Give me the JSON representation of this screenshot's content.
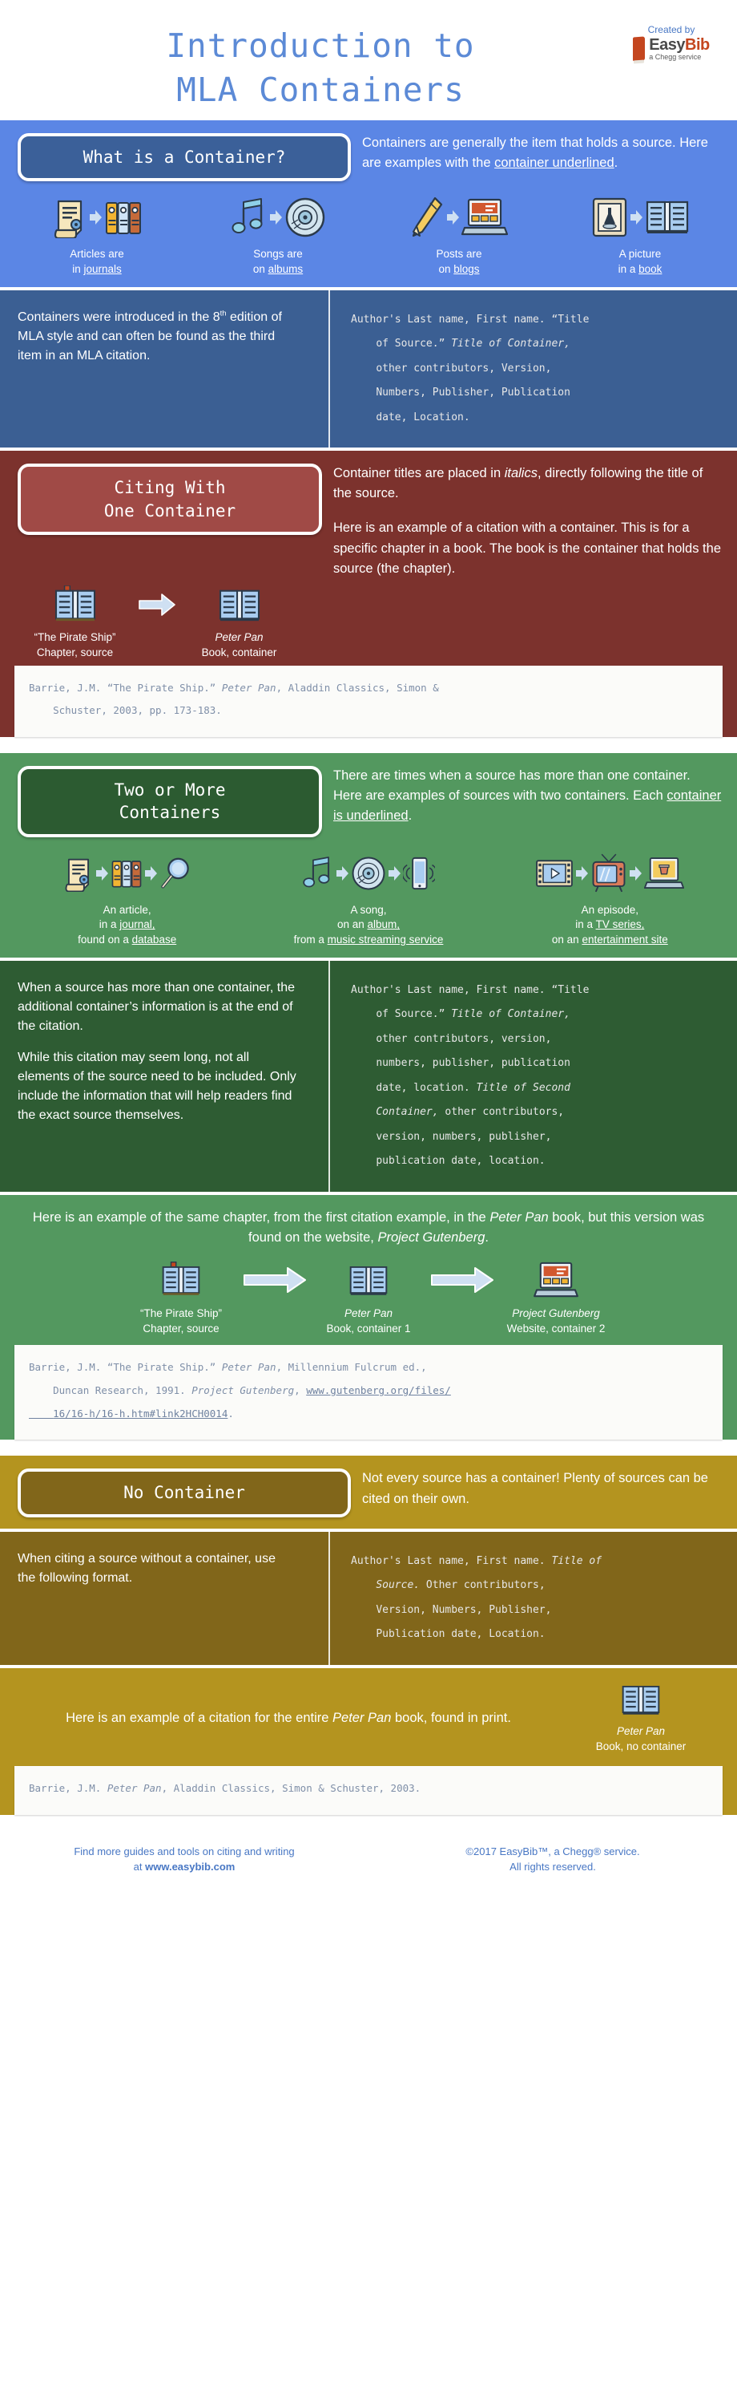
{
  "header": {
    "title_line1": "Introduction to",
    "title_line2": "MLA Containers",
    "created_by": "Created by",
    "logo_easy": "Easy",
    "logo_bib": "Bib",
    "logo_sub": "a Chegg service"
  },
  "section_what": {
    "badge": "What is a Container?",
    "intro_a": "Containers are generally the item that holds a source. Here are examples with the ",
    "intro_underline": "container underlined",
    "intro_b": ".",
    "examples": [
      {
        "icon_source": "article-scroll-icon",
        "icon_arrow": "arrow-right-icon",
        "icon_container": "books-row-icon",
        "line1": "Articles are",
        "line2_pre": "in ",
        "line2_underline": "journals",
        "line2_post": ""
      },
      {
        "icon_source": "music-notes-icon",
        "icon_arrow": "arrow-right-icon",
        "icon_container": "vinyl-disc-icon",
        "line1": "Songs are",
        "line2_pre": "on ",
        "line2_underline": "albums",
        "line2_post": ""
      },
      {
        "icon_source": "pencil-icon",
        "icon_arrow": "arrow-right-icon",
        "icon_container": "laptop-icon",
        "line1": "Posts are",
        "line2_pre": "on ",
        "line2_underline": "blogs",
        "line2_post": ""
      },
      {
        "icon_source": "framed-picture-icon",
        "icon_arrow": "arrow-right-icon",
        "icon_container": "open-book-icon",
        "line1": "A picture",
        "line2_pre": "in a ",
        "line2_underline": "book",
        "line2_post": ""
      }
    ],
    "body_pre": "Containers were introduced in the 8",
    "body_sup": "th",
    "body_post": " edition of MLA style and can often be found as the third item in an MLA citation.",
    "format": "Author's Last name, First name. “Title\n    of Source.” @@Title of Container,@@\n    other contributors, Version,\n    Numbers, Publisher, Publication\n    date, Location."
  },
  "section_one": {
    "badge_line1": "Citing With",
    "badge_line2": "One Container",
    "text_p1_a": "Container titles are placed in ",
    "text_p1_i": "italics",
    "text_p1_b": ", directly following the title of the source.",
    "text_p2": "Here is an example of a citation with a container. This is for a specific chapter in a book. The book is the container that holds the source (the chapter).",
    "flow": [
      {
        "icon": "open-book-bookmark-icon",
        "cap1": "“The Pirate Ship”",
        "cap2": "Chapter, source",
        "italic1": false
      },
      {
        "icon": "open-book-icon",
        "cap1": "Peter Pan",
        "cap2": "Book, container",
        "italic1": true
      }
    ],
    "arrow_icon": "arrow-right-large-icon",
    "citation": "Barrie, J.M. “The Pirate Ship.” @@Peter Pan@@, Aladdin Classics, Simon &\n    Schuster, 2003, pp. 173-183."
  },
  "section_two": {
    "badge_line1": "Two or More",
    "badge_line2": "Containers",
    "intro_a": "There are times when a source has more than one container. Here are examples of sources with two containers. Each ",
    "intro_underline": "container is underlined",
    "intro_b": ".",
    "examples": [
      {
        "icons": [
          "article-scroll-icon",
          "arrow-right-icon",
          "books-row-icon",
          "arrow-right-icon",
          "magnifier-icon"
        ],
        "lines": [
          {
            "pre": "An article,",
            "u": "",
            "post": ""
          },
          {
            "pre": "in a ",
            "u": "journal,",
            "post": ""
          },
          {
            "pre": "found on a ",
            "u": "database",
            "post": ""
          }
        ]
      },
      {
        "icons": [
          "music-notes-icon",
          "arrow-right-icon",
          "vinyl-disc-icon",
          "arrow-right-icon",
          "smartphone-icon"
        ],
        "lines": [
          {
            "pre": "A song,",
            "u": "",
            "post": ""
          },
          {
            "pre": "on an ",
            "u": "album,",
            "post": ""
          },
          {
            "pre": "from a ",
            "u": "music streaming service",
            "post": ""
          }
        ]
      },
      {
        "icons": [
          "film-strip-icon",
          "arrow-right-icon",
          "television-icon",
          "arrow-right-icon",
          "laptop-video-icon"
        ],
        "lines": [
          {
            "pre": "An episode,",
            "u": "",
            "post": ""
          },
          {
            "pre": "in a ",
            "u": "TV series,",
            "post": ""
          },
          {
            "pre": "on an ",
            "u": "entertainment site",
            "post": ""
          }
        ]
      }
    ],
    "body_p1": "When a source has more than one container, the additional container’s information is at the end of the citation.",
    "body_p2": "While this citation may seem long, not all elements of the source need to be included. Only include the information that will help readers find the exact source themselves.",
    "format": "Author's Last name, First name. “Title\n    of Source.” @@Title of Container,@@\n    other contributors, version,\n    numbers, publisher, publication\n    date, location. @@Title of Second\n    Container,@@ other contributors,\n    version, numbers, publisher,\n    publication date, location."
  },
  "section_gutenberg": {
    "head_a": "Here is an example of the same chapter, from the first citation example, in the ",
    "head_i": "Peter Pan",
    "head_b": " book, but this version was found on the website, ",
    "head_i2": "Project Gutenberg",
    "head_c": ".",
    "flow": [
      {
        "icon": "open-book-bookmark-icon",
        "cap1": "“The Pirate Ship”",
        "cap2": "Chapter, source",
        "italic1": false
      },
      {
        "icon": "open-book-icon",
        "cap1": "Peter Pan",
        "cap2": "Book, container 1",
        "italic1": true
      },
      {
        "icon": "laptop-icon",
        "cap1": "Project Gutenberg",
        "cap2": "Website, container 2",
        "italic1": true
      }
    ],
    "arrow_icon": "arrow-right-large-icon",
    "citation_pre": "Barrie, J.M. “The Pirate Ship.” ",
    "citation_i1": "Peter Pan",
    "citation_mid": ", Millennium Fulcrum ed.,\n    Duncan Research, 1991. ",
    "citation_i2": "Project Gutenberg",
    "citation_post": ", ",
    "citation_url": "www.gutenberg.org/files/\n    16/16-h/16-h.htm#link2HCH0014",
    "citation_end": "."
  },
  "section_none": {
    "badge": "No Container",
    "intro": "Not every source has a container! Plenty of sources can be cited on their own.",
    "body": "When citing a source without a container, use the following format.",
    "format": "Author's Last name, First name. @@Title of\n    Source.@@ Other contributors,\n    Version, Numbers, Publisher,\n    Publication date, Location.",
    "example_a": "Here is an example of a citation for the entire ",
    "example_i": "Peter Pan",
    "example_b": " book, found in print.",
    "example_icon": "open-book-icon",
    "example_cap1": "Peter Pan",
    "example_cap2": "Book, no container",
    "citation_pre": "Barrie, J.M. ",
    "citation_i": "Peter Pan",
    "citation_post": ", Aladdin Classics, Simon & Schuster, 2003."
  },
  "footer": {
    "left_line1": "Find more guides and tools on citing and writing",
    "left_line2_pre": "at ",
    "left_line2_bold": "www.easybib.com",
    "right_line1": "©2017  EasyBib™, a Chegg® service.",
    "right_line2": "All rights reserved."
  },
  "colors": {
    "blue_light": "#5b86e5",
    "blue_dark": "#3b5f93",
    "red": "#7c322d",
    "green_light": "#53985f",
    "green_dark": "#2e5c33",
    "gold_dark": "#81661a",
    "gold_light": "#b4941f",
    "title_blue": "#5c8ad6"
  }
}
